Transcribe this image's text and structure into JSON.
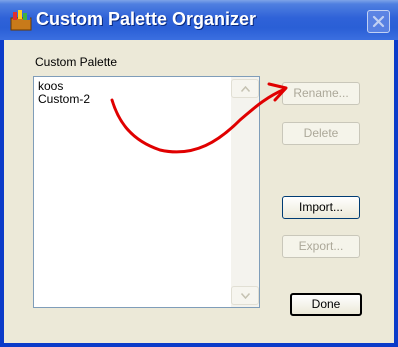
{
  "window": {
    "title": "Custom Palette Organizer"
  },
  "palette": {
    "label": "Custom Palette",
    "items": [
      "koos",
      "Custom-2"
    ]
  },
  "buttons": {
    "rename": "Rename...",
    "delete": "Delete",
    "import": "Import...",
    "export": "Export...",
    "done": "Done"
  },
  "colors": {
    "titlebar": "#2a5fd6",
    "annotation_arrow": "#e00000",
    "disabled_text": "#aca899"
  },
  "icons": [
    "app-icon",
    "close-icon",
    "scroll-up-icon",
    "scroll-down-icon"
  ]
}
